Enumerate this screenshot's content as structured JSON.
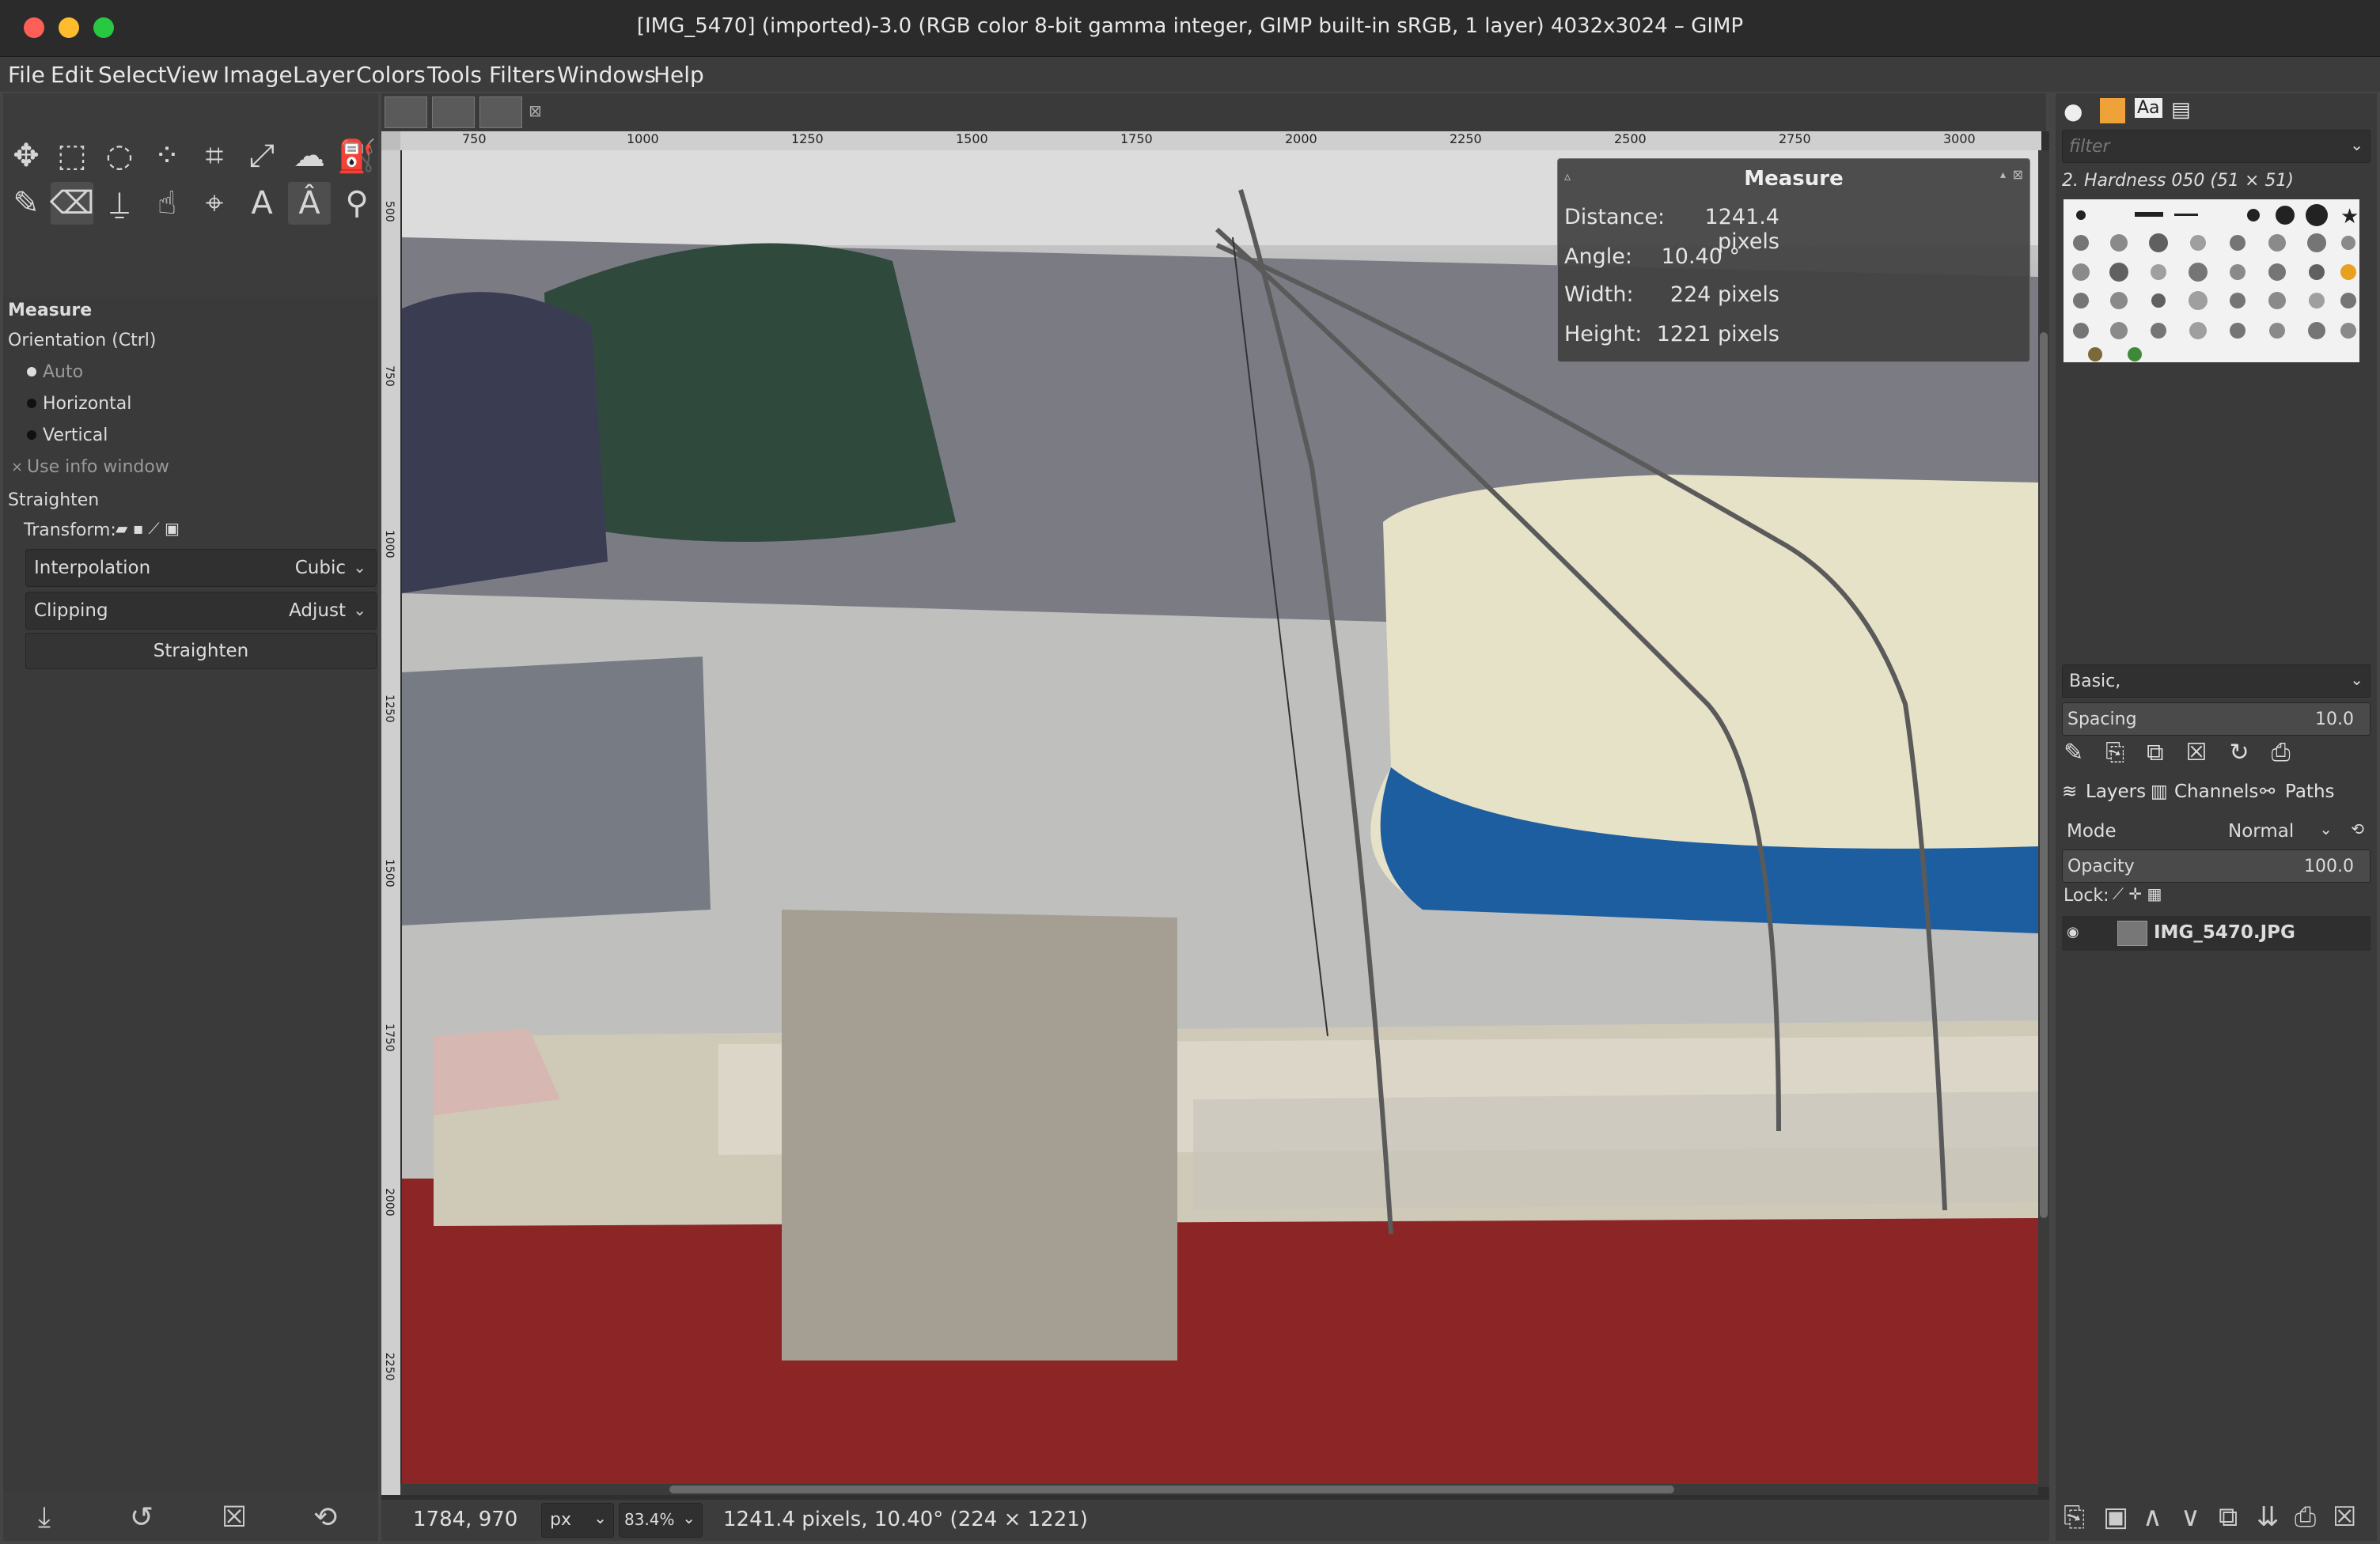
{
  "window": {
    "title": "[IMG_5470] (imported)-3.0 (RGB color 8-bit gamma integer, GIMP built-in sRGB, 1 layer) 4032x3024 – GIMP",
    "traffic_colors": {
      "close": "#ff5f57",
      "minimize": "#febc2e",
      "zoom": "#28c840"
    }
  },
  "menubar": [
    "File",
    "Edit",
    "Select",
    "View",
    "Image",
    "Layer",
    "Colors",
    "Tools",
    "Filters",
    "Windows",
    "Help"
  ],
  "toolbox": {
    "tools": [
      "move-tool",
      "rect-select-tool",
      "free-select-tool",
      "fuzzy-select-tool",
      "crop-tool",
      "unified-transform-tool",
      "warp-tool",
      "bucket-fill-tool",
      "paintbrush-tool",
      "eraser-tool",
      "clone-tool",
      "smudge-tool",
      "path-tool",
      "text-tool",
      "measure-tool",
      "zoom-tool"
    ],
    "active_tool": "measure-tool"
  },
  "tool_options": {
    "title": "Measure",
    "orientation_label": "Orientation  (Ctrl)",
    "orientation_options": [
      "Auto",
      "Horizontal",
      "Vertical"
    ],
    "use_info_window": "Use info window",
    "straighten_section": "Straighten",
    "transform_label": "Transform:",
    "interpolation_label": "Interpolation",
    "interpolation_value": "Cubic",
    "clipping_label": "Clipping",
    "clipping_value": "Adjust",
    "straighten_button": "Straighten"
  },
  "rulers": {
    "h_ticks": [
      "750",
      "1000",
      "1250",
      "1500",
      "1750",
      "2000",
      "2250",
      "2500",
      "2750",
      "3000"
    ],
    "v_ticks": [
      "500",
      "750",
      "1000",
      "1250",
      "1500",
      "1750",
      "2000",
      "2250"
    ]
  },
  "measure_window": {
    "title": "Measure",
    "rows": [
      {
        "label": "Distance:",
        "value": "1241.4 pixels"
      },
      {
        "label": "Angle:",
        "value": "10.40 °"
      },
      {
        "label": "Width:",
        "value": "224 pixels"
      },
      {
        "label": "Height:",
        "value": "1221 pixels"
      }
    ]
  },
  "statusbar": {
    "coords": "1784, 970",
    "unit": "px",
    "zoom": "83.4%",
    "message": "1241.4 pixels, 10.40° (224 × 1221)"
  },
  "brushes": {
    "filter_placeholder": "filter",
    "current_brush": "2. Hardness 050 (51 × 51)",
    "preset": "Basic,",
    "spacing_label": "Spacing",
    "spacing_value": "10.0"
  },
  "layers": {
    "tabs": [
      "Layers",
      "Channels",
      "Paths"
    ],
    "mode_label": "Mode",
    "mode_value": "Normal",
    "opacity_label": "Opacity",
    "opacity_value": "100.0",
    "lock_label": "Lock:",
    "layer_name": "IMG_5470.JPG"
  }
}
